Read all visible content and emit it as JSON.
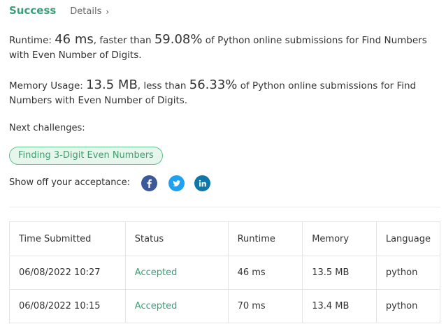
{
  "header": {
    "status": "Success",
    "details_label": "Details"
  },
  "runtime_stat": {
    "label": "Runtime:",
    "value": "46 ms",
    "comparison": ", faster than",
    "percent": "59.08%",
    "suffix": "of Python online submissions for Find Numbers with Even Number of Digits."
  },
  "memory_stat": {
    "label": "Memory Usage:",
    "value": "13.5 MB",
    "comparison": ", less than",
    "percent": "56.33%",
    "suffix": "of Python online submissions for Find Numbers with Even Number of Digits."
  },
  "next": {
    "label": "Next challenges:",
    "challenge": "Finding 3-Digit Even Numbers"
  },
  "share": {
    "label": "Show off your acceptance:",
    "icons": [
      "facebook-icon",
      "twitter-icon",
      "linkedin-icon"
    ]
  },
  "colors": {
    "accent": "#3a9e78",
    "facebook": "#3b5998",
    "twitter": "#1da1f2",
    "linkedin": "#0e76a8"
  },
  "submissions": {
    "headers": [
      "Time Submitted",
      "Status",
      "Runtime",
      "Memory",
      "Language"
    ],
    "rows": [
      [
        "06/08/2022 10:27",
        "Accepted",
        "46 ms",
        "13.5 MB",
        "python"
      ],
      [
        "06/08/2022 10:15",
        "Accepted",
        "70 ms",
        "13.4 MB",
        "python"
      ]
    ]
  }
}
